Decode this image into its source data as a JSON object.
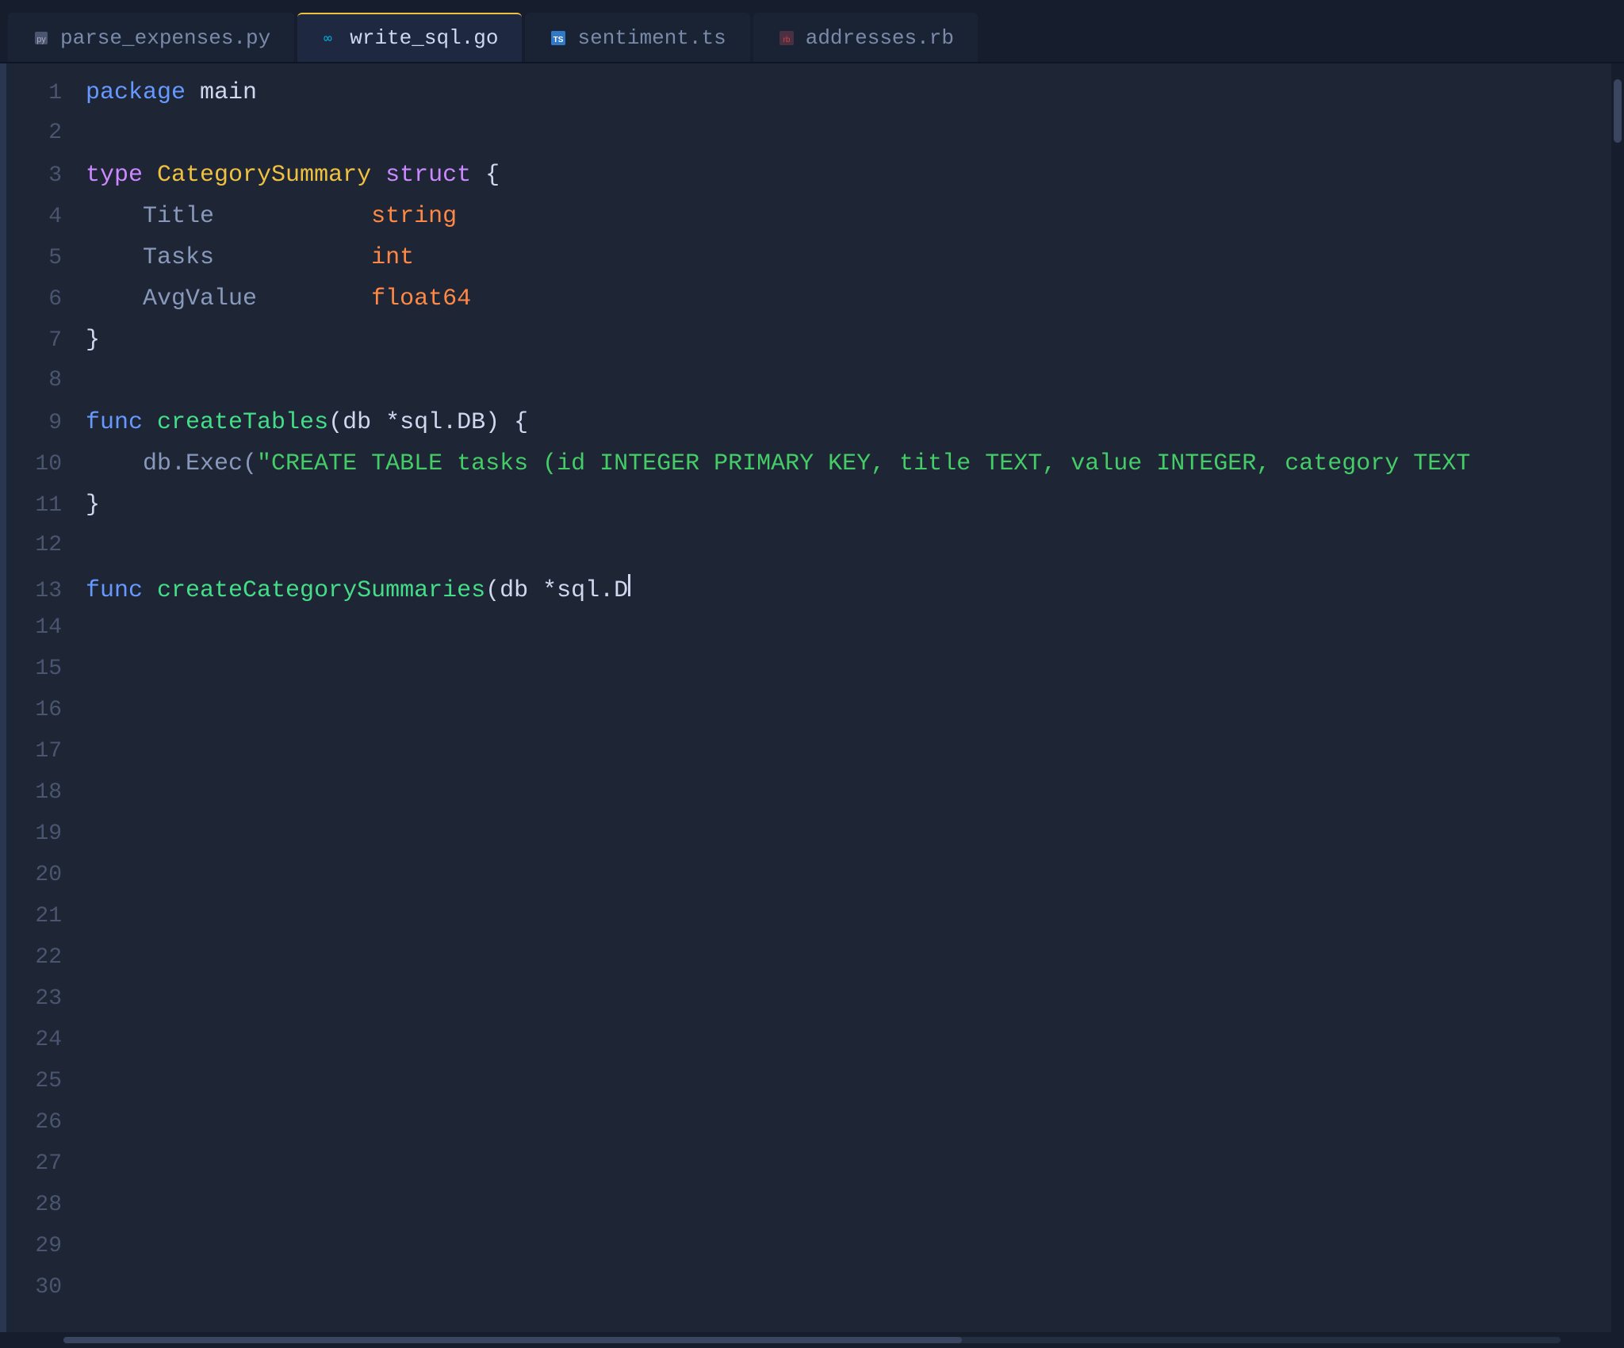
{
  "tabs": [
    {
      "id": "parse_expenses",
      "label": "parse_expenses.py",
      "type": "py",
      "icon": "🐍",
      "active": false
    },
    {
      "id": "write_sql",
      "label": "write_sql.go",
      "type": "go",
      "icon": "∞",
      "active": true
    },
    {
      "id": "sentiment",
      "label": "sentiment.ts",
      "type": "ts",
      "icon": "TS",
      "active": false
    },
    {
      "id": "addresses",
      "label": "addresses.rb",
      "type": "rb",
      "icon": "💎",
      "active": false
    }
  ],
  "code": {
    "lines": [
      {
        "num": 1,
        "tokens": [
          {
            "text": "package",
            "cls": "kw-blue"
          },
          {
            "text": " ",
            "cls": "kw-white"
          },
          {
            "text": "main",
            "cls": "kw-main"
          }
        ]
      },
      {
        "num": 2,
        "tokens": []
      },
      {
        "num": 3,
        "tokens": [
          {
            "text": "type",
            "cls": "kw-purple"
          },
          {
            "text": " ",
            "cls": ""
          },
          {
            "text": "CategorySummary",
            "cls": "kw-yellow"
          },
          {
            "text": " ",
            "cls": ""
          },
          {
            "text": "struct",
            "cls": "kw-purple"
          },
          {
            "text": " {",
            "cls": "kw-white"
          }
        ]
      },
      {
        "num": 4,
        "tokens": [
          {
            "text": "    Title",
            "cls": "kw-gray"
          },
          {
            "text": "           ",
            "cls": ""
          },
          {
            "text": "string",
            "cls": "kw-string"
          }
        ]
      },
      {
        "num": 5,
        "tokens": [
          {
            "text": "    Tasks",
            "cls": "kw-gray"
          },
          {
            "text": "           ",
            "cls": ""
          },
          {
            "text": "int",
            "cls": "kw-string"
          }
        ]
      },
      {
        "num": 6,
        "tokens": [
          {
            "text": "    AvgValue",
            "cls": "kw-gray"
          },
          {
            "text": "        ",
            "cls": ""
          },
          {
            "text": "float64",
            "cls": "kw-string"
          }
        ]
      },
      {
        "num": 7,
        "tokens": [
          {
            "text": "}",
            "cls": "kw-white"
          }
        ]
      },
      {
        "num": 8,
        "tokens": []
      },
      {
        "num": 9,
        "tokens": [
          {
            "text": "func",
            "cls": "kw-blue"
          },
          {
            "text": " ",
            "cls": ""
          },
          {
            "text": "createTables",
            "cls": "kw-green"
          },
          {
            "text": "(db *sql.DB) {",
            "cls": "kw-white"
          }
        ]
      },
      {
        "num": 10,
        "tokens": [
          {
            "text": "    db.Exec(",
            "cls": "kw-gray"
          },
          {
            "text": "\"CREATE TABLE tasks (id INTEGER PRIMARY KEY, title TEXT, value INTEGER, category TEXT",
            "cls": "kw-green-str"
          }
        ]
      },
      {
        "num": 11,
        "tokens": [
          {
            "text": "}",
            "cls": "kw-white"
          }
        ]
      },
      {
        "num": 12,
        "tokens": []
      },
      {
        "num": 13,
        "tokens": [
          {
            "text": "func",
            "cls": "kw-blue"
          },
          {
            "text": " ",
            "cls": ""
          },
          {
            "text": "createCategorySummaries",
            "cls": "kw-green"
          },
          {
            "text": "(db *sql.D",
            "cls": "kw-white"
          },
          {
            "text": "|cursor|",
            "cls": "cursor-placeholder"
          }
        ]
      },
      {
        "num": 14,
        "tokens": []
      },
      {
        "num": 15,
        "tokens": []
      },
      {
        "num": 16,
        "tokens": []
      },
      {
        "num": 17,
        "tokens": []
      },
      {
        "num": 18,
        "tokens": []
      },
      {
        "num": 19,
        "tokens": []
      },
      {
        "num": 20,
        "tokens": []
      },
      {
        "num": 21,
        "tokens": []
      },
      {
        "num": 22,
        "tokens": []
      },
      {
        "num": 23,
        "tokens": []
      },
      {
        "num": 24,
        "tokens": []
      },
      {
        "num": 25,
        "tokens": []
      },
      {
        "num": 26,
        "tokens": []
      },
      {
        "num": 27,
        "tokens": []
      },
      {
        "num": 28,
        "tokens": []
      },
      {
        "num": 29,
        "tokens": []
      },
      {
        "num": 30,
        "tokens": []
      }
    ]
  },
  "colors": {
    "bg": "#1e2535",
    "tabBarBg": "#161e2e",
    "activeTab": "#1e2840",
    "activeTabBorder": "#f0c040",
    "lineNumber": "#4a5570",
    "gutterBg": "#1a2535"
  }
}
